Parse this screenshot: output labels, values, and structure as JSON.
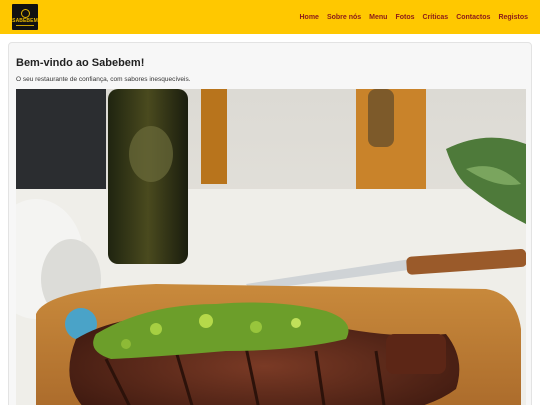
{
  "navbar": {
    "logo_text": "SABEBEM",
    "links": [
      "Home",
      "Sobre nós",
      "Menu",
      "Fotos",
      "Críticas",
      "Contactos",
      "Registos"
    ]
  },
  "hero": {
    "title": "Bem-vindo ao Sabebem!",
    "subtitle": "O seu restaurante de confiança, com sabores inesquecíveis."
  },
  "colors": {
    "navbar_bg": "#ffc800",
    "nav_link": "#8b1a1a",
    "card_bg": "#f7f7f7"
  }
}
